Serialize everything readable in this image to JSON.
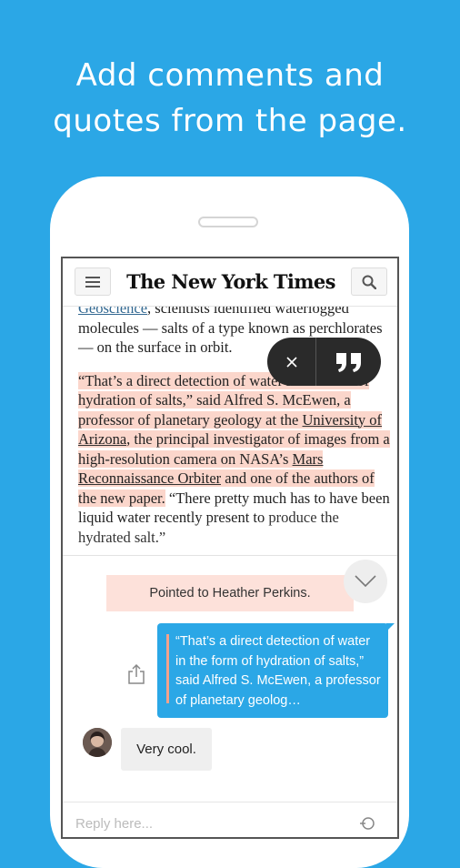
{
  "headline": {
    "line1": "Add comments and",
    "line2": "quotes from the page."
  },
  "nyt": {
    "masthead": "The New York Times",
    "menu_icon": "hamburger-menu-icon",
    "search_icon": "search-icon"
  },
  "article": {
    "p1_link": "Geoscience",
    "p1_text": ", scientists identified waterlogged molecules — salts of a type known as perchlorates — on the surface in orbit.",
    "p2_h1": "“That’s a direct detection of water in the form of hydration of salts,” said Alfred S. McEwen, a professor of planetary geology at the ",
    "p2_u1": "University of Arizona",
    "p2_h2": ", the principal investigator of images from a high-resolution camera on NASA’s ",
    "p2_u2": "Mars Reconnaissance Orbiter",
    "p2_h3": " and one of the authors of the new paper.",
    "p2_rest": " “There pretty much has to have been liquid water recently present to",
    "p2_cut": "produce the hydrated salt.”"
  },
  "selection_toolbar": {
    "close_icon": "close-icon",
    "quote_icon": "quote-icon"
  },
  "chat": {
    "pointed_text": "Pointed to Heather Perkins.",
    "quote_text": "“That’s a direct detection of water in the form of hydration of salts,” said Alfred S. McEwen, a professor of planetary geolog…",
    "reply_text": "Very cool.",
    "composer_placeholder": "Reply here...",
    "collapse_icon": "chevron-down-icon",
    "share_icon": "share-icon"
  },
  "colors": {
    "background": "#2ba7e6",
    "highlight": "#fbd6cb",
    "quote_bubble": "#2ba7e6",
    "pointed_badge": "#fde1da"
  }
}
